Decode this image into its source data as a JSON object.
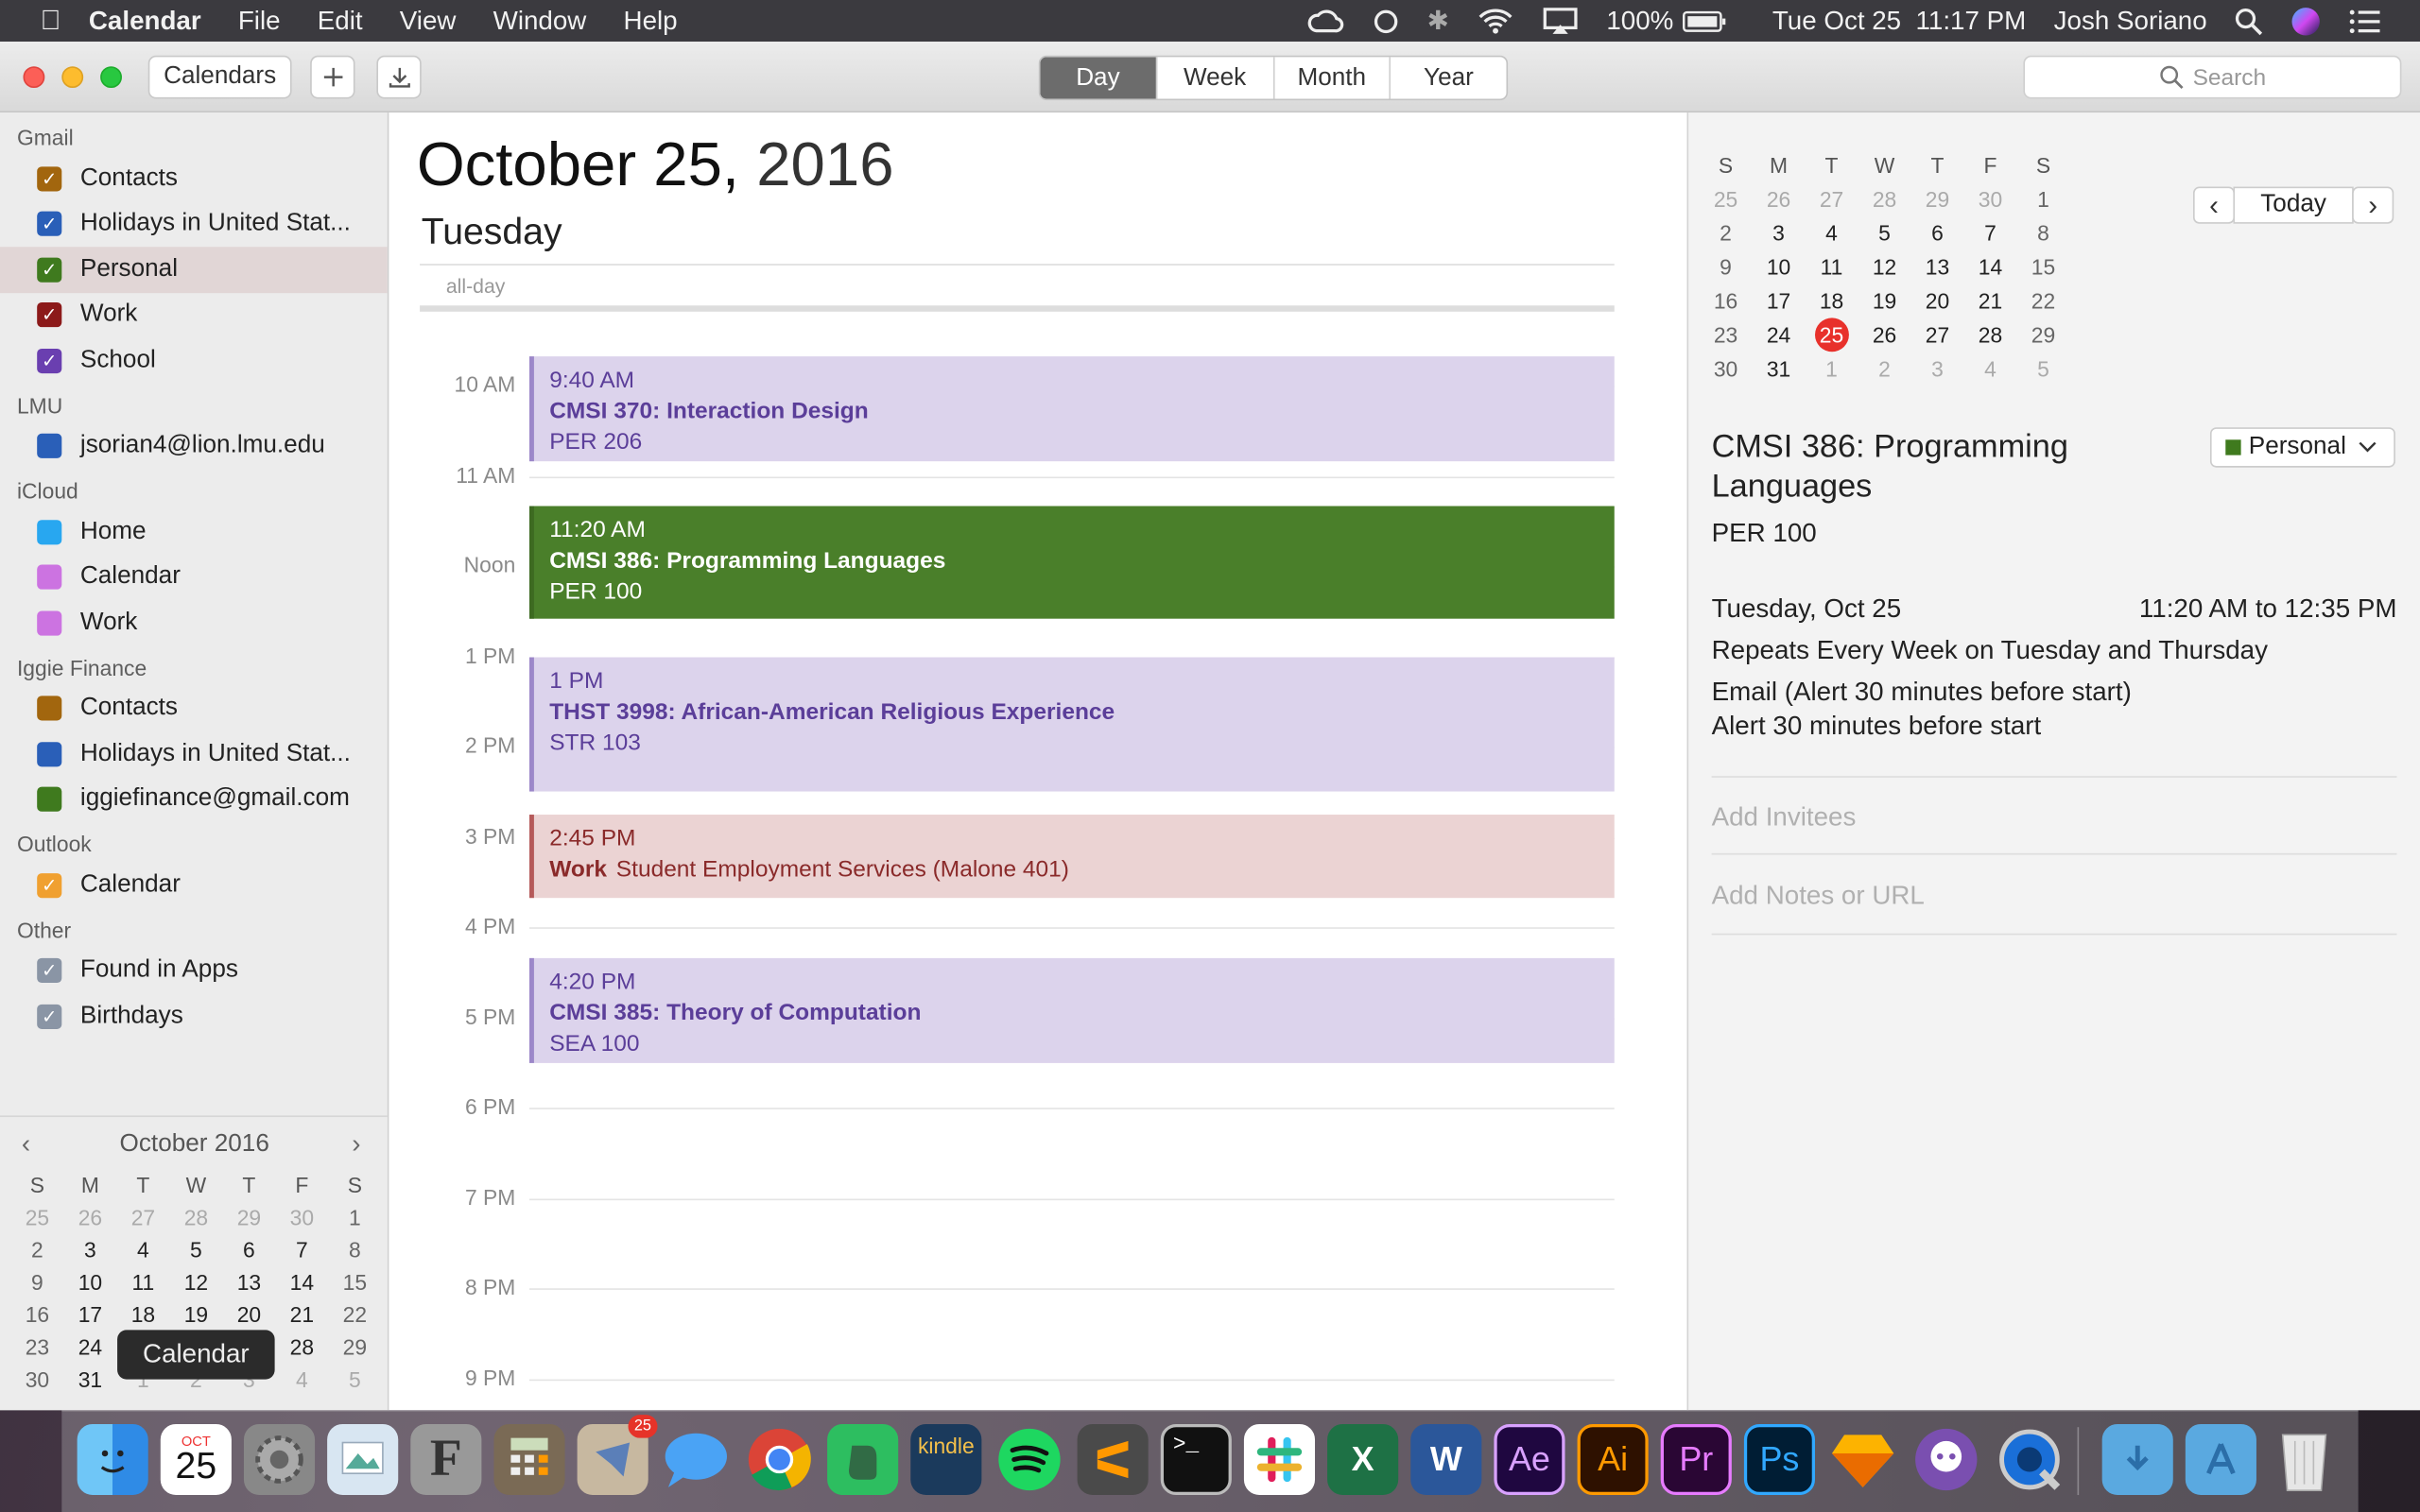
{
  "menubar": {
    "app": "Calendar",
    "menus": [
      "File",
      "Edit",
      "View",
      "Window",
      "Help"
    ],
    "battery": "100%",
    "clock": "Tue Oct 25  11:17 PM",
    "user": "Josh Soriano"
  },
  "toolbar": {
    "calendars_label": "Calendars",
    "views": [
      "Day",
      "Week",
      "Month",
      "Year"
    ],
    "active_view": "Day",
    "search_placeholder": "Search"
  },
  "sidebar": {
    "groups": [
      {
        "name": "Gmail",
        "items": [
          {
            "label": "Contacts",
            "color": "#a2660e",
            "checked": true
          },
          {
            "label": "Holidays in United Stat...",
            "color": "#2a5fb8",
            "checked": true
          },
          {
            "label": "Personal",
            "color": "#3f7a1e",
            "checked": true
          },
          {
            "label": "Work",
            "color": "#8c1a1a",
            "checked": true
          },
          {
            "label": "School",
            "color": "#6a3fb0",
            "checked": true
          }
        ]
      },
      {
        "name": "LMU",
        "items": [
          {
            "label": "jsorian4@lion.lmu.edu",
            "color": "#2a5fb8",
            "checked": false
          }
        ]
      },
      {
        "name": "iCloud",
        "items": [
          {
            "label": "Home",
            "color": "#28a7f0",
            "checked": false
          },
          {
            "label": "Calendar",
            "color": "#cc73e1",
            "checked": false
          },
          {
            "label": "Work",
            "color": "#cc73e1",
            "checked": false
          }
        ]
      },
      {
        "name": "Iggie Finance",
        "items": [
          {
            "label": "Contacts",
            "color": "#a2660e",
            "checked": false
          },
          {
            "label": "Holidays in United Stat...",
            "color": "#2a5fb8",
            "checked": false
          },
          {
            "label": "iggiefinance@gmail.com",
            "color": "#3f7a1e",
            "checked": false
          }
        ]
      },
      {
        "name": "Outlook",
        "items": [
          {
            "label": "Calendar",
            "color": "#f0a030",
            "checked": true
          }
        ]
      },
      {
        "name": "Other",
        "items": [
          {
            "label": "Found in Apps",
            "color": "#8a95a5",
            "checked": true
          },
          {
            "label": "Birthdays",
            "color": "#8a95a5",
            "checked": true
          }
        ]
      }
    ],
    "mini_month": "October 2016"
  },
  "calendar_grid": {
    "weekdays": [
      "S",
      "M",
      "T",
      "W",
      "T",
      "F",
      "S"
    ],
    "weeks": [
      [
        "25",
        "26",
        "27",
        "28",
        "29",
        "30",
        "1"
      ],
      [
        "2",
        "3",
        "4",
        "5",
        "6",
        "7",
        "8"
      ],
      [
        "9",
        "10",
        "11",
        "12",
        "13",
        "14",
        "15"
      ],
      [
        "16",
        "17",
        "18",
        "19",
        "20",
        "21",
        "22"
      ],
      [
        "23",
        "24",
        "25",
        "26",
        "27",
        "28",
        "29"
      ],
      [
        "30",
        "31",
        "1",
        "2",
        "3",
        "4",
        "5"
      ]
    ],
    "today": "25"
  },
  "day_view": {
    "date_main": "October 25,",
    "year": "2016",
    "weekday": "Tuesday",
    "all_day_label": "all-day",
    "hours": [
      "10 AM",
      "11 AM",
      "Noon",
      "1 PM",
      "2 PM",
      "3 PM",
      "4 PM",
      "5 PM",
      "6 PM",
      "7 PM",
      "8 PM",
      "9 PM"
    ],
    "events": [
      {
        "time": "9:40 AM",
        "title": "CMSI 370: Interaction Design",
        "location": "PER 206",
        "style": "purple"
      },
      {
        "time": "11:20 AM",
        "title": "CMSI 386: Programming Languages",
        "location": "PER 100",
        "style": "green"
      },
      {
        "time": "1 PM",
        "title": "THST 3998: African-American Religious Experience",
        "location": "STR 103",
        "style": "purple"
      },
      {
        "time": "2:45 PM",
        "title": "Work",
        "location": "Student Employment Services (Malone 401)",
        "style": "red"
      },
      {
        "time": "4:20 PM",
        "title": "CMSI 385: Theory of Computation",
        "location": "SEA 100",
        "style": "purple"
      }
    ]
  },
  "detail": {
    "today_label": "Today",
    "title": "CMSI 386: Programming Languages",
    "calendar": "Personal",
    "location": "PER 100",
    "date": "Tuesday, Oct 25",
    "time_range": "11:20 AM to 12:35 PM",
    "repeat": "Repeats Every Week on Tuesday and Thursday",
    "alert1": "Email (Alert 30 minutes before start)",
    "alert2": "Alert 30 minutes before start",
    "invitees_placeholder": "Add Invitees",
    "notes_placeholder": "Add Notes or URL"
  },
  "dock": {
    "tooltip": "Calendar",
    "calendar_month": "OCT",
    "calendar_day": "25",
    "mail_badge": "25",
    "apps": [
      "Finder",
      "Calendar",
      "System Preferences",
      "Preview",
      "Font",
      "Calculator",
      "Mail",
      "Messages",
      "Chrome",
      "Evernote",
      "Kindle",
      "Spotify",
      "Sublime Text",
      "Terminal",
      "Slack",
      "Excel",
      "Word",
      "After Effects",
      "Illustrator",
      "Premiere",
      "Photoshop",
      "Sketch",
      "GitHub",
      "QuickTime",
      "Downloads",
      "Applications",
      "Trash"
    ],
    "labels": {
      "kindle": "kindle",
      "ae": "Ae",
      "ai": "Ai",
      "pr": "Pr",
      "ps": "Ps",
      "xl": "X",
      "wd": "W",
      "font": "F",
      "term": ">_"
    }
  }
}
